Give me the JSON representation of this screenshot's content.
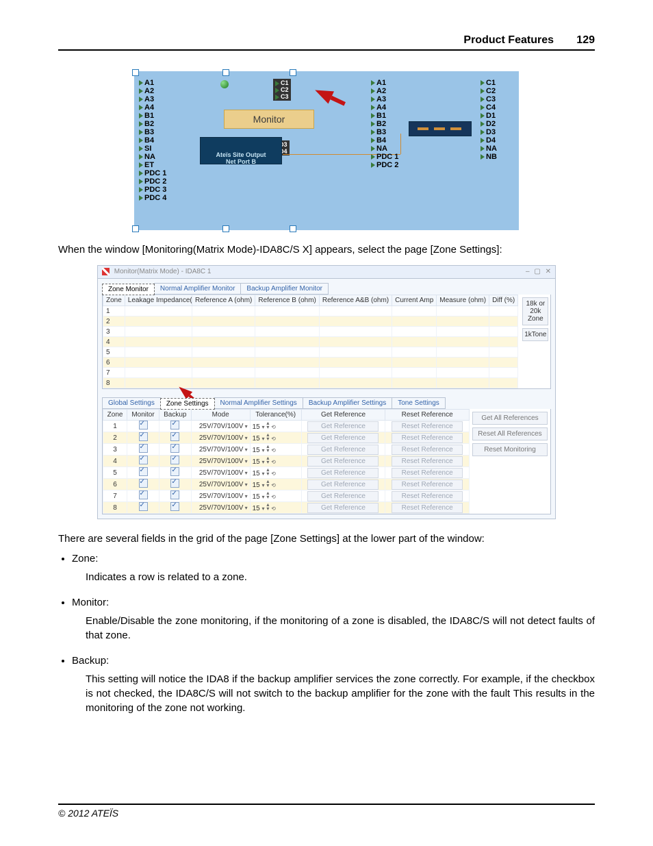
{
  "header": {
    "section": "Product Features",
    "page_number": "129"
  },
  "footer": {
    "copyright": "© 2012 ATEÏS"
  },
  "fig1": {
    "monitor_label": "Monitor",
    "site_label_line1": "Ateïs Site Output",
    "site_label_line2": "Net Port B",
    "left_labels": [
      "A1",
      "A2",
      "A3",
      "A4",
      "B1",
      "B2",
      "B3",
      "B4",
      "SI",
      "NA",
      "ET",
      "PDC 1",
      "PDC 2",
      "PDC 3",
      "PDC 4"
    ],
    "mid_small_labels": [
      "C1",
      "C2",
      "C3"
    ],
    "mid_d_labels": [
      "D3",
      "D4"
    ],
    "mid_labels": [
      "A1",
      "A2",
      "A3",
      "A4",
      "B1",
      "B2",
      "B3",
      "B4",
      "NA",
      "PDC 1",
      "PDC 2"
    ],
    "right_labels": [
      "C1",
      "C2",
      "C3",
      "C4",
      "D1",
      "D2",
      "D3",
      "D4",
      "NA",
      "NB"
    ]
  },
  "para1": "When the window [Monitoring(Matrix Mode)-IDA8C/S X] appears, select the page [Zone Settings]:",
  "fig2": {
    "window_title": "Monitor(Matrix Mode) - IDA8C 1",
    "upper_tabs": [
      "Zone Monitor",
      "Normal Amplifier Monitor",
      "Backup Amplifier Monitor"
    ],
    "upper_active_tab": 0,
    "upper_left_cols": [
      "Zone",
      "Leakage Impedance(ohm)"
    ],
    "upper_right_cols": [
      "Reference A (ohm)",
      "Reference B (ohm)",
      "Reference A&B (ohm)",
      "Current Amp",
      "Measure (ohm)",
      "Diff (%)"
    ],
    "upper_zones": [
      "1",
      "2",
      "3",
      "4",
      "5",
      "6",
      "7",
      "8"
    ],
    "button_18k20k": "18k or 20k Zone",
    "button_1ktone": "1kTone",
    "lower_tabs": [
      "Global Settings",
      "Zone Settings",
      "Normal Amplifier Settings",
      "Backup Amplifier Settings",
      "Tone Settings"
    ],
    "lower_active_tab": 1,
    "lower_cols": [
      "Zone",
      "Monitor",
      "Backup",
      "Mode",
      "Tolerance(%)",
      "Get Reference",
      "Reset Reference"
    ],
    "side_buttons": [
      "Get All References",
      "Reset All References",
      "Reset Monitoring"
    ],
    "lower_rows": [
      {
        "zone": "1",
        "mode": "25V/70V/100V",
        "tol": "15",
        "get": "Get Reference",
        "reset": "Reset Reference"
      },
      {
        "zone": "2",
        "mode": "25V/70V/100V",
        "tol": "15",
        "get": "Get Reference",
        "reset": "Reset Reference"
      },
      {
        "zone": "3",
        "mode": "25V/70V/100V",
        "tol": "15",
        "get": "Get Reference",
        "reset": "Reset Reference"
      },
      {
        "zone": "4",
        "mode": "25V/70V/100V",
        "tol": "15",
        "get": "Get Reference",
        "reset": "Reset Reference"
      },
      {
        "zone": "5",
        "mode": "25V/70V/100V",
        "tol": "15",
        "get": "Get Reference",
        "reset": "Reset Reference"
      },
      {
        "zone": "6",
        "mode": "25V/70V/100V",
        "tol": "15",
        "get": "Get Reference",
        "reset": "Reset Reference"
      },
      {
        "zone": "7",
        "mode": "25V/70V/100V",
        "tol": "15",
        "get": "Get Reference",
        "reset": "Reset Reference"
      },
      {
        "zone": "8",
        "mode": "25V/70V/100V",
        "tol": "15",
        "get": "Get Reference",
        "reset": "Reset Reference"
      }
    ]
  },
  "para2": "There are several fields in the grid of the page [Zone Settings]  at the lower part of the window:",
  "bullets": {
    "zone_label": "Zone:",
    "zone_desc": "Indicates a row is related to a zone.",
    "monitor_label": "Monitor:",
    "monitor_desc": "Enable/Disable the zone monitoring, if the monitoring of a zone is disabled, the IDA8C/S will not detect faults of that zone.",
    "backup_label": "Backup:",
    "backup_desc": "This setting will notice the IDA8 if the backup amplifier services the zone correctly. For example, if the checkbox is not checked, the IDA8C/S will not switch to the backup amplifier for the zone with the fault This results in the monitoring of the zone not working."
  }
}
